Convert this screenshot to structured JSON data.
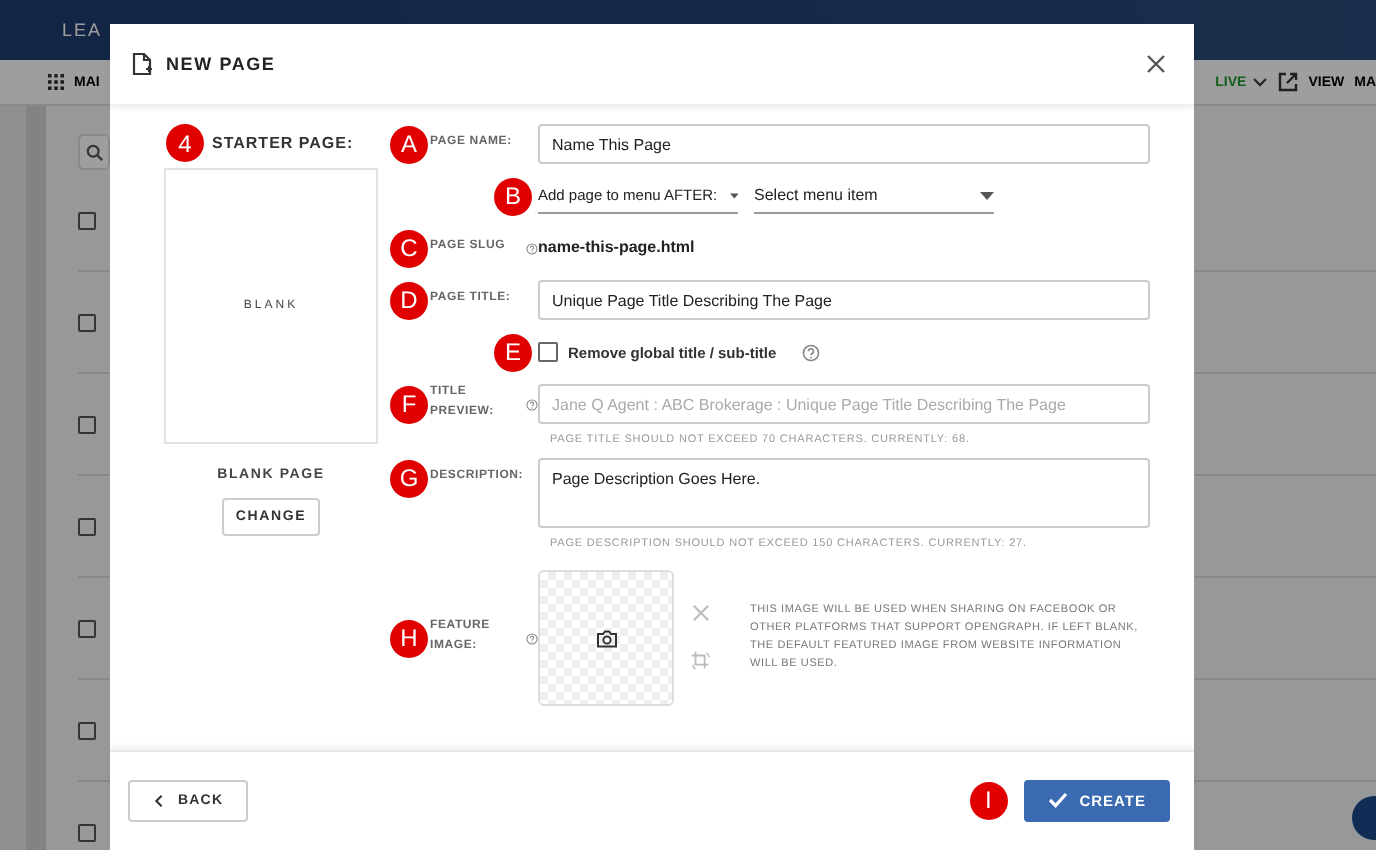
{
  "app": {
    "nav_item": "LEA",
    "menu_label": "MAI",
    "status": "LIVE",
    "view": "VIEW",
    "more": "MA",
    "rows": [
      {
        "checked": false
      },
      {
        "checked": false
      },
      {
        "checked": false
      },
      {
        "checked": false
      },
      {
        "checked": false
      },
      {
        "checked": false
      },
      {
        "checked": false
      }
    ]
  },
  "modal": {
    "title": "NEW PAGE",
    "starter": {
      "marker": "4",
      "label": "STARTER PAGE:",
      "preview": "BLANK",
      "name": "BLANK PAGE",
      "button": "CHANGE"
    },
    "fields": [
      {
        "kind": "text",
        "marker": "A",
        "label": "PAGE NAME:",
        "help": false,
        "value": "Name This Page"
      },
      {
        "kind": "select",
        "marker": "B",
        "value": "Add page to menu AFTER:",
        "placeholder": "Select menu item"
      },
      {
        "kind": "slug",
        "marker": "C",
        "label": "PAGE SLUG",
        "help": true,
        "value": "name-this-page.html"
      },
      {
        "kind": "text",
        "marker": "D",
        "label": "PAGE TITLE:",
        "help": false,
        "value": "Unique Page Title Describing The Page"
      },
      {
        "kind": "checkbox",
        "marker": "E",
        "label": "Remove global title / sub-title",
        "checked": false,
        "help": true
      },
      {
        "kind": "text",
        "marker": "F",
        "label": "TITLE PREVIEW:",
        "help": true,
        "placeholder": "Jane Q Agent : ABC Brokerage : Unique Page Title Describing The Page",
        "hint": "PAGE TITLE SHOULD NOT EXCEED 70 CHARACTERS. CURRENTLY: 68."
      },
      {
        "kind": "textarea",
        "marker": "G",
        "label": "DESCRIPTION:",
        "help": false,
        "value": "Page Description Goes Here.",
        "hint": "PAGE DESCRIPTION SHOULD NOT EXCEED 150 CHARACTERS. CURRENTLY: 27."
      },
      {
        "kind": "image",
        "marker": "H",
        "label": "FEATURE IMAGE:",
        "help": true,
        "note": "THIS IMAGE WILL BE USED WHEN SHARING ON FACEBOOK OR OTHER PLATFORMS THAT SUPPORT OPENGRAPH. IF LEFT BLANK, THE DEFAULT FEATURED IMAGE FROM WEBSITE INFORMATION WILL BE USED."
      }
    ],
    "footer": {
      "back": "BACK",
      "marker": "I",
      "create": "CREATE"
    }
  }
}
